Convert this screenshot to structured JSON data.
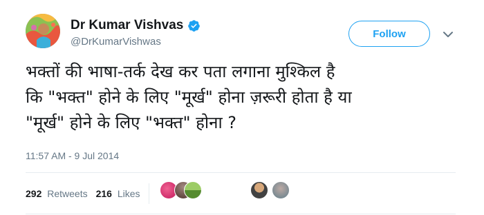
{
  "tweet": {
    "author_name": "Dr Kumar Vishvas",
    "author_handle": "@DrKumarVishwas",
    "follow_label": "Follow",
    "text": "भक्तों की भाषा-तर्क देख कर पता लगाना मुश्किल है\nकि \"भक्त\" होने के लिए \"मूर्ख\" होना ज़रूरी होता है या\n\"मूर्ख\" होने के लिए \"भक्त\" होना ?",
    "timestamp": "11:57 AM - 9 Jul 2014",
    "retweets_count": "292",
    "retweets_label": "Retweets",
    "likes_count": "216",
    "likes_label": "Likes"
  },
  "icons": {
    "verified": "verified-badge-icon",
    "chevron": "chevron-down-icon"
  },
  "colors": {
    "accent": "#1da1f2",
    "text": "#14171a",
    "muted": "#657786",
    "divider": "#e6ecf0"
  }
}
